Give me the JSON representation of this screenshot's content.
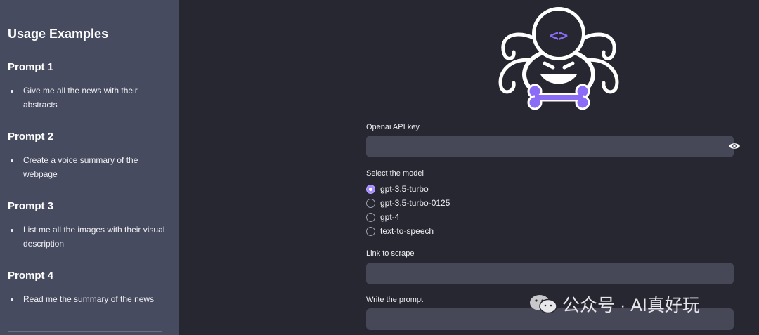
{
  "sidebar": {
    "title": "Usage Examples",
    "prompts": [
      {
        "heading": "Prompt 1",
        "lines": [
          "Give me all the news with their",
          "abstracts"
        ]
      },
      {
        "heading": "Prompt 2",
        "lines": [
          "Create a voice summary of the",
          "webpage"
        ]
      },
      {
        "heading": "Prompt 3",
        "lines": [
          "List me all the images with their visual",
          "description"
        ]
      },
      {
        "heading": "Prompt 4",
        "lines": [
          "Read me the summary of the news"
        ]
      }
    ]
  },
  "main": {
    "logo": {
      "icon": "spider-robot-logo-icon",
      "code_symbol": "<>"
    },
    "api_key": {
      "label": "Openai API key",
      "value": "",
      "icon": "eye-icon"
    },
    "model": {
      "label": "Select the model",
      "options": [
        "gpt-3.5-turbo",
        "gpt-3.5-turbo-0125",
        "gpt-4",
        "text-to-speech"
      ],
      "selected": "gpt-3.5-turbo"
    },
    "link": {
      "label": "Link to scrape",
      "value": ""
    },
    "prompt": {
      "label": "Write the prompt",
      "value": ""
    }
  },
  "watermark": {
    "text": "公众号 · AI真好玩",
    "icon": "wechat-icon"
  },
  "colors": {
    "accent": "#8b6cf6",
    "sidebar_bg": "#474b5f",
    "main_bg": "#262730",
    "input_bg": "#464857"
  }
}
